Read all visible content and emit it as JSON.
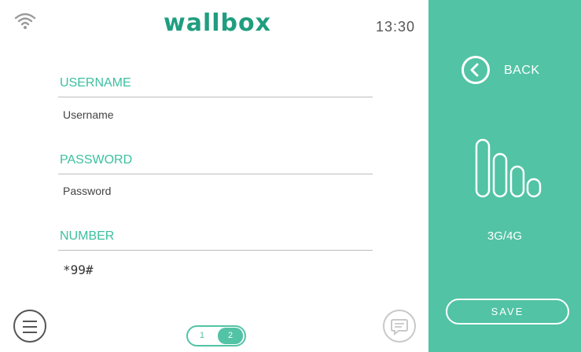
{
  "header": {
    "brand": "wallbox",
    "time": "13:30",
    "wifi_icon": "wifi-icon"
  },
  "form": {
    "username_label": "USERNAME",
    "username_placeholder": "Username",
    "password_label": "PASSWORD",
    "password_placeholder": "Password",
    "number_label": "NUMBER",
    "number_value": "*99#"
  },
  "footer": {
    "menu_icon": "menu-icon",
    "chat_icon": "chat-icon",
    "pager": {
      "page1": "1",
      "page2": "2",
      "current": 2
    }
  },
  "side_panel": {
    "back_label": "BACK",
    "network_label": "3G/4G",
    "save_label": "SAVE",
    "signal_icon": "signal-icon"
  },
  "colors": {
    "accent": "#52c3a5",
    "brand": "#1f9e7f",
    "label": "#3cc0a0"
  }
}
